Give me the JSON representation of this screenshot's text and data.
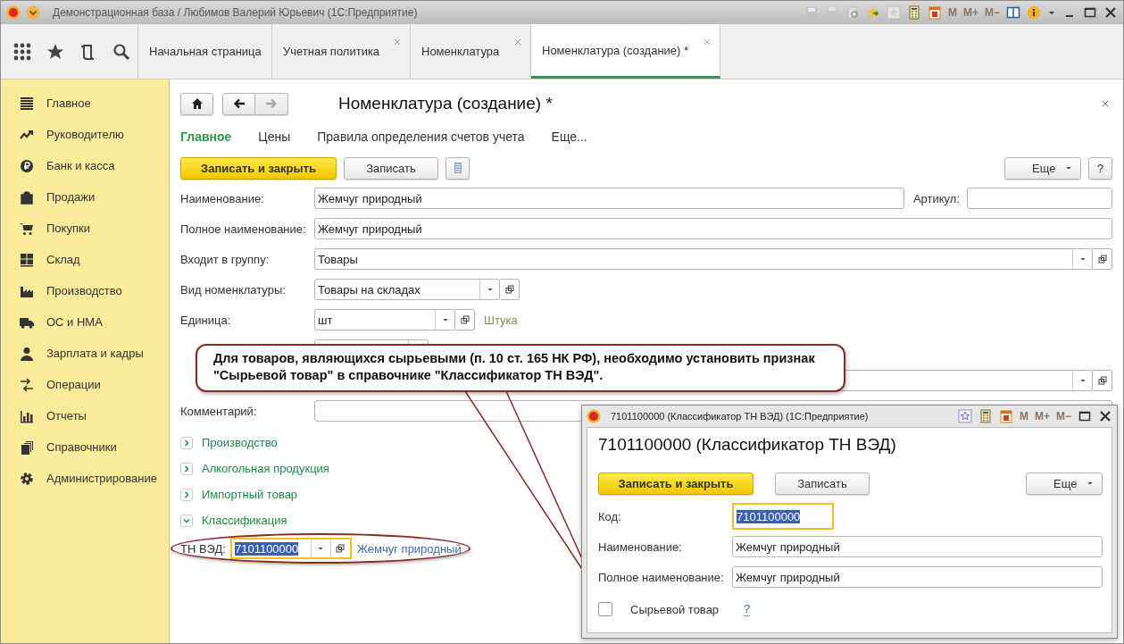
{
  "window": {
    "title": "Демонстрационная база / Любимов Валерий Юрьевич  (1С:Предприятие)",
    "memory_keys": [
      "M",
      "M+",
      "M−"
    ]
  },
  "tabs": [
    {
      "label": "Начальная страница",
      "closable": false,
      "selected": false
    },
    {
      "label": "Учетная политика",
      "closable": true,
      "selected": false
    },
    {
      "label": "Номенклатура",
      "closable": true,
      "selected": false
    },
    {
      "label": "Номенклатура (создание) *",
      "closable": true,
      "selected": true
    }
  ],
  "sidebar": {
    "items": [
      {
        "label": "Главное",
        "kind": "list"
      },
      {
        "label": "Руководителю",
        "kind": "trend"
      },
      {
        "label": "Банк и касса",
        "kind": "coin"
      },
      {
        "label": "Продажи",
        "kind": "bag"
      },
      {
        "label": "Покупки",
        "kind": "cart"
      },
      {
        "label": "Склад",
        "kind": "grid"
      },
      {
        "label": "Производство",
        "kind": "factory"
      },
      {
        "label": "ОС и НМА",
        "kind": "truck"
      },
      {
        "label": "Зарплата и кадры",
        "kind": "person"
      },
      {
        "label": "Операции",
        "kind": "arrows"
      },
      {
        "label": "Отчеты",
        "kind": "bars"
      },
      {
        "label": "Справочники",
        "kind": "books"
      },
      {
        "label": "Администрирование",
        "kind": "gear"
      }
    ]
  },
  "form": {
    "title": "Номенклатура (создание) *",
    "nav": [
      {
        "label": "Главное",
        "selected": true
      },
      {
        "label": "Цены",
        "selected": false
      },
      {
        "label": "Правила определения счетов учета",
        "selected": false
      },
      {
        "label": "Еще...",
        "selected": false
      }
    ],
    "buttons": {
      "primary": "Записать и закрыть",
      "save": "Записать",
      "more": "Еще",
      "help": "?"
    },
    "fields": [
      {
        "kind": "name",
        "label": "Наименование:",
        "value": "Жемчуг природный",
        "extra_label": "Артикул:"
      },
      {
        "kind": "text",
        "label": "Полное наименование:",
        "value": "Жемчуг природный"
      },
      {
        "kind": "select",
        "label": "Входит в группу:",
        "value": "Товары"
      },
      {
        "kind": "select_short",
        "label": "Вид номенклатуры:",
        "value": "Товары на складах"
      },
      {
        "kind": "select_small",
        "label": "Единица:",
        "value": "шт",
        "hint": "Штука"
      },
      {
        "kind": "covered_small"
      },
      {
        "kind": "covered"
      },
      {
        "kind": "text",
        "label": "Комментарий:"
      }
    ],
    "sections": [
      {
        "label": "Производство",
        "expanded": false
      },
      {
        "label": "Алкогольная продукция",
        "expanded": false
      },
      {
        "label": "Импортный товар",
        "expanded": false
      },
      {
        "label": "Классификация",
        "expanded": true
      }
    ],
    "tn_ved": {
      "label": "ТН ВЭД:",
      "value": "7101100000",
      "link": "Жемчуг природный"
    }
  },
  "callout": {
    "text": "Для товаров, являющихся сырьевыми (п. 10 ст. 165 НК РФ), необходимо установить признак \"Сырьевой товар\" в справочнике \"Классификатор ТН ВЭД\"."
  },
  "dialog": {
    "title": "7101100000 (Классификатор ТН ВЭД)  (1С:Предприятие)",
    "heading": "7101100000 (Классификатор ТН ВЭД)",
    "buttons": {
      "primary": "Записать и закрыть",
      "save": "Записать",
      "more": "Еще"
    },
    "fields": [
      {
        "label": "Код:",
        "value": "7101100000",
        "focused": true
      },
      {
        "label": "Наименование:",
        "value": "Жемчуг природный",
        "focused": false
      },
      {
        "label": "Полное наименование:",
        "value": "Жемчуг природный",
        "focused": false
      }
    ],
    "checkbox": {
      "label": "Сырьевой товар",
      "checked": false
    },
    "help": "?",
    "memory_keys": [
      "M",
      "M+",
      "M−"
    ]
  }
}
